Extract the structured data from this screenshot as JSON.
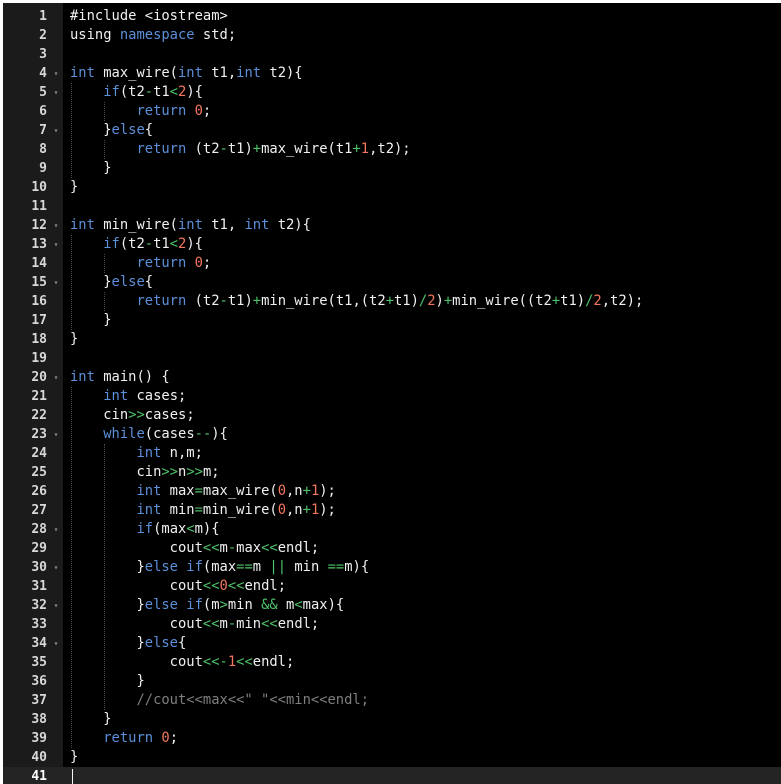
{
  "editor": {
    "colors": {
      "background": "#000000",
      "gutter": "#1b1b1b",
      "keyword": "#5b8fd8",
      "number": "#f2775e",
      "operator": "#4fc36a",
      "comment": "#7e7e7e",
      "text": "#f0f0f0"
    },
    "fold_marker_icon": "triangle-down-icon",
    "active_line": 41,
    "lines": [
      {
        "n": "1",
        "fold": false,
        "tokens": [
          [
            "t-plain",
            "#include <iostream>"
          ]
        ]
      },
      {
        "n": "2",
        "fold": false,
        "tokens": [
          [
            "t-plain",
            "using "
          ],
          [
            "t-kw",
            "namespace"
          ],
          [
            "t-plain",
            " std;"
          ]
        ]
      },
      {
        "n": "3",
        "fold": false,
        "tokens": []
      },
      {
        "n": "4",
        "fold": true,
        "tokens": [
          [
            "t-kw",
            "int"
          ],
          [
            "t-plain",
            " max_wire("
          ],
          [
            "t-kw",
            "int"
          ],
          [
            "t-plain",
            " t1,"
          ],
          [
            "t-kw",
            "int"
          ],
          [
            "t-plain",
            " t2){"
          ]
        ]
      },
      {
        "n": "5",
        "fold": true,
        "tokens": [
          [
            "t-plain",
            "    "
          ],
          [
            "t-kw",
            "if"
          ],
          [
            "t-plain",
            "(t2"
          ],
          [
            "t-op",
            "-"
          ],
          [
            "t-plain",
            "t1"
          ],
          [
            "t-op",
            "<"
          ],
          [
            "t-num",
            "2"
          ],
          [
            "t-plain",
            "){"
          ]
        ]
      },
      {
        "n": "6",
        "fold": false,
        "tokens": [
          [
            "t-plain",
            "        "
          ],
          [
            "t-kw",
            "return"
          ],
          [
            "t-plain",
            " "
          ],
          [
            "t-num",
            "0"
          ],
          [
            "t-plain",
            ";"
          ]
        ]
      },
      {
        "n": "7",
        "fold": true,
        "tokens": [
          [
            "t-plain",
            "    }"
          ],
          [
            "t-kw",
            "else"
          ],
          [
            "t-plain",
            "{"
          ]
        ]
      },
      {
        "n": "8",
        "fold": false,
        "tokens": [
          [
            "t-plain",
            "        "
          ],
          [
            "t-kw",
            "return"
          ],
          [
            "t-plain",
            " (t2"
          ],
          [
            "t-op",
            "-"
          ],
          [
            "t-plain",
            "t1)"
          ],
          [
            "t-op",
            "+"
          ],
          [
            "t-plain",
            "max_wire(t1"
          ],
          [
            "t-op",
            "+"
          ],
          [
            "t-num",
            "1"
          ],
          [
            "t-plain",
            ",t2);"
          ]
        ]
      },
      {
        "n": "9",
        "fold": false,
        "tokens": [
          [
            "t-plain",
            "    }"
          ]
        ]
      },
      {
        "n": "10",
        "fold": false,
        "tokens": [
          [
            "t-plain",
            "}"
          ]
        ]
      },
      {
        "n": "11",
        "fold": false,
        "tokens": []
      },
      {
        "n": "12",
        "fold": true,
        "tokens": [
          [
            "t-kw",
            "int"
          ],
          [
            "t-plain",
            " min_wire("
          ],
          [
            "t-kw",
            "int"
          ],
          [
            "t-plain",
            " t1, "
          ],
          [
            "t-kw",
            "int"
          ],
          [
            "t-plain",
            " t2){"
          ]
        ]
      },
      {
        "n": "13",
        "fold": true,
        "tokens": [
          [
            "t-plain",
            "    "
          ],
          [
            "t-kw",
            "if"
          ],
          [
            "t-plain",
            "(t2"
          ],
          [
            "t-op",
            "-"
          ],
          [
            "t-plain",
            "t1"
          ],
          [
            "t-op",
            "<"
          ],
          [
            "t-num",
            "2"
          ],
          [
            "t-plain",
            "){"
          ]
        ]
      },
      {
        "n": "14",
        "fold": false,
        "tokens": [
          [
            "t-plain",
            "        "
          ],
          [
            "t-kw",
            "return"
          ],
          [
            "t-plain",
            " "
          ],
          [
            "t-num",
            "0"
          ],
          [
            "t-plain",
            ";"
          ]
        ]
      },
      {
        "n": "15",
        "fold": true,
        "tokens": [
          [
            "t-plain",
            "    }"
          ],
          [
            "t-kw",
            "else"
          ],
          [
            "t-plain",
            "{"
          ]
        ]
      },
      {
        "n": "16",
        "fold": false,
        "tokens": [
          [
            "t-plain",
            "        "
          ],
          [
            "t-kw",
            "return"
          ],
          [
            "t-plain",
            " (t2"
          ],
          [
            "t-op",
            "-"
          ],
          [
            "t-plain",
            "t1)"
          ],
          [
            "t-op",
            "+"
          ],
          [
            "t-plain",
            "min_wire(t1,(t2"
          ],
          [
            "t-op",
            "+"
          ],
          [
            "t-plain",
            "t1)"
          ],
          [
            "t-op",
            "/"
          ],
          [
            "t-num",
            "2"
          ],
          [
            "t-plain",
            ")"
          ],
          [
            "t-op",
            "+"
          ],
          [
            "t-plain",
            "min_wire((t2"
          ],
          [
            "t-op",
            "+"
          ],
          [
            "t-plain",
            "t1)"
          ],
          [
            "t-op",
            "/"
          ],
          [
            "t-num",
            "2"
          ],
          [
            "t-plain",
            ",t2);"
          ]
        ]
      },
      {
        "n": "17",
        "fold": false,
        "tokens": [
          [
            "t-plain",
            "    }"
          ]
        ]
      },
      {
        "n": "18",
        "fold": false,
        "tokens": [
          [
            "t-plain",
            "}"
          ]
        ]
      },
      {
        "n": "19",
        "fold": false,
        "tokens": []
      },
      {
        "n": "20",
        "fold": true,
        "tokens": [
          [
            "t-kw",
            "int"
          ],
          [
            "t-plain",
            " main() {"
          ]
        ]
      },
      {
        "n": "21",
        "fold": false,
        "tokens": [
          [
            "t-plain",
            "    "
          ],
          [
            "t-kw",
            "int"
          ],
          [
            "t-plain",
            " cases;"
          ]
        ]
      },
      {
        "n": "22",
        "fold": false,
        "tokens": [
          [
            "t-plain",
            "    cin"
          ],
          [
            "t-op",
            ">>"
          ],
          [
            "t-plain",
            "cases;"
          ]
        ]
      },
      {
        "n": "23",
        "fold": true,
        "tokens": [
          [
            "t-plain",
            "    "
          ],
          [
            "t-kw",
            "while"
          ],
          [
            "t-plain",
            "(cases"
          ],
          [
            "t-op",
            "--"
          ],
          [
            "t-plain",
            "){"
          ]
        ]
      },
      {
        "n": "24",
        "fold": false,
        "tokens": [
          [
            "t-plain",
            "        "
          ],
          [
            "t-kw",
            "int"
          ],
          [
            "t-plain",
            " n,m;"
          ]
        ]
      },
      {
        "n": "25",
        "fold": false,
        "tokens": [
          [
            "t-plain",
            "        cin"
          ],
          [
            "t-op",
            ">>"
          ],
          [
            "t-plain",
            "n"
          ],
          [
            "t-op",
            ">>"
          ],
          [
            "t-plain",
            "m;"
          ]
        ]
      },
      {
        "n": "26",
        "fold": false,
        "tokens": [
          [
            "t-plain",
            "        "
          ],
          [
            "t-kw",
            "int"
          ],
          [
            "t-plain",
            " max"
          ],
          [
            "t-op",
            "="
          ],
          [
            "t-plain",
            "max_wire("
          ],
          [
            "t-num",
            "0"
          ],
          [
            "t-plain",
            ",n"
          ],
          [
            "t-op",
            "+"
          ],
          [
            "t-num",
            "1"
          ],
          [
            "t-plain",
            ");"
          ]
        ]
      },
      {
        "n": "27",
        "fold": false,
        "tokens": [
          [
            "t-plain",
            "        "
          ],
          [
            "t-kw",
            "int"
          ],
          [
            "t-plain",
            " min"
          ],
          [
            "t-op",
            "="
          ],
          [
            "t-plain",
            "min_wire("
          ],
          [
            "t-num",
            "0"
          ],
          [
            "t-plain",
            ",n"
          ],
          [
            "t-op",
            "+"
          ],
          [
            "t-num",
            "1"
          ],
          [
            "t-plain",
            ");"
          ]
        ]
      },
      {
        "n": "28",
        "fold": true,
        "tokens": [
          [
            "t-plain",
            "        "
          ],
          [
            "t-kw",
            "if"
          ],
          [
            "t-plain",
            "(max"
          ],
          [
            "t-op",
            "<"
          ],
          [
            "t-plain",
            "m){"
          ]
        ]
      },
      {
        "n": "29",
        "fold": false,
        "tokens": [
          [
            "t-plain",
            "            cout"
          ],
          [
            "t-op",
            "<<"
          ],
          [
            "t-plain",
            "m"
          ],
          [
            "t-op",
            "-"
          ],
          [
            "t-plain",
            "max"
          ],
          [
            "t-op",
            "<<"
          ],
          [
            "t-plain",
            "endl;"
          ]
        ]
      },
      {
        "n": "30",
        "fold": true,
        "tokens": [
          [
            "t-plain",
            "        }"
          ],
          [
            "t-kw",
            "else if"
          ],
          [
            "t-plain",
            "(max"
          ],
          [
            "t-op",
            "=="
          ],
          [
            "t-plain",
            "m "
          ],
          [
            "t-op",
            "||"
          ],
          [
            "t-plain",
            " min "
          ],
          [
            "t-op",
            "=="
          ],
          [
            "t-plain",
            "m){"
          ]
        ]
      },
      {
        "n": "31",
        "fold": false,
        "tokens": [
          [
            "t-plain",
            "            cout"
          ],
          [
            "t-op",
            "<<"
          ],
          [
            "t-num",
            "0"
          ],
          [
            "t-op",
            "<<"
          ],
          [
            "t-plain",
            "endl;"
          ]
        ]
      },
      {
        "n": "32",
        "fold": true,
        "tokens": [
          [
            "t-plain",
            "        }"
          ],
          [
            "t-kw",
            "else if"
          ],
          [
            "t-plain",
            "(m"
          ],
          [
            "t-op",
            ">"
          ],
          [
            "t-plain",
            "min "
          ],
          [
            "t-op",
            "&&"
          ],
          [
            "t-plain",
            " m"
          ],
          [
            "t-op",
            "<"
          ],
          [
            "t-plain",
            "max){"
          ]
        ]
      },
      {
        "n": "33",
        "fold": false,
        "tokens": [
          [
            "t-plain",
            "            cout"
          ],
          [
            "t-op",
            "<<"
          ],
          [
            "t-plain",
            "m"
          ],
          [
            "t-op",
            "-"
          ],
          [
            "t-plain",
            "min"
          ],
          [
            "t-op",
            "<<"
          ],
          [
            "t-plain",
            "endl;"
          ]
        ]
      },
      {
        "n": "34",
        "fold": true,
        "tokens": [
          [
            "t-plain",
            "        }"
          ],
          [
            "t-kw",
            "else"
          ],
          [
            "t-plain",
            "{"
          ]
        ]
      },
      {
        "n": "35",
        "fold": false,
        "tokens": [
          [
            "t-plain",
            "            cout"
          ],
          [
            "t-op",
            "<<-"
          ],
          [
            "t-num",
            "1"
          ],
          [
            "t-op",
            "<<"
          ],
          [
            "t-plain",
            "endl;"
          ]
        ]
      },
      {
        "n": "36",
        "fold": false,
        "tokens": [
          [
            "t-plain",
            "        }"
          ]
        ]
      },
      {
        "n": "37",
        "fold": false,
        "tokens": [
          [
            "t-plain",
            "        "
          ],
          [
            "t-cmt",
            "//cout<<max<<\" \"<<min<<endl;"
          ]
        ]
      },
      {
        "n": "38",
        "fold": false,
        "tokens": [
          [
            "t-plain",
            "    }"
          ]
        ]
      },
      {
        "n": "39",
        "fold": false,
        "tokens": [
          [
            "t-plain",
            "    "
          ],
          [
            "t-kw",
            "return"
          ],
          [
            "t-plain",
            " "
          ],
          [
            "t-num",
            "0"
          ],
          [
            "t-plain",
            ";"
          ]
        ]
      },
      {
        "n": "40",
        "fold": false,
        "tokens": [
          [
            "t-plain",
            "}"
          ]
        ]
      },
      {
        "n": "41",
        "fold": false,
        "tokens": []
      }
    ]
  }
}
